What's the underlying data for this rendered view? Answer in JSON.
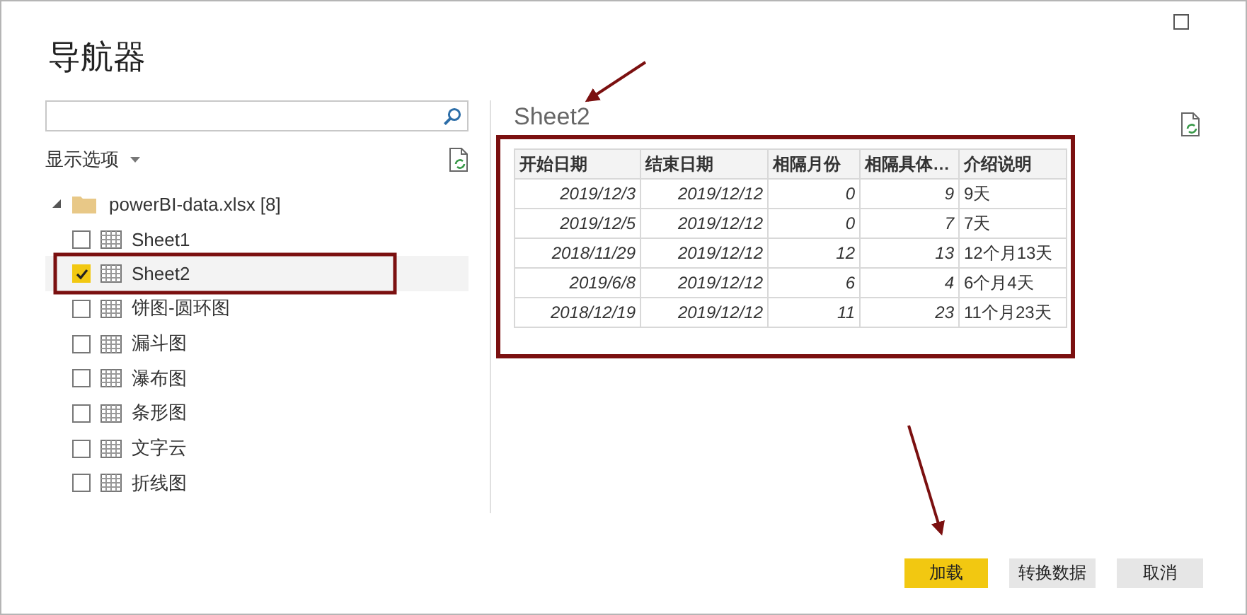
{
  "window": {
    "title": "导航器"
  },
  "display_options": {
    "label": "显示选项"
  },
  "tree": {
    "label": "powerBI-data.xlsx [8]",
    "expanded": true,
    "children": [
      {
        "label": "Sheet1",
        "checked": false,
        "selected": false
      },
      {
        "label": "Sheet2",
        "checked": true,
        "selected": true
      },
      {
        "label": "饼图-圆环图",
        "checked": false,
        "selected": false
      },
      {
        "label": "漏斗图",
        "checked": false,
        "selected": false
      },
      {
        "label": "瀑布图",
        "checked": false,
        "selected": false
      },
      {
        "label": "条形图",
        "checked": false,
        "selected": false
      },
      {
        "label": "文字云",
        "checked": false,
        "selected": false
      },
      {
        "label": "折线图",
        "checked": false,
        "selected": false
      }
    ]
  },
  "preview": {
    "title": "Sheet2",
    "table": {
      "columns": [
        "开始日期",
        "结束日期",
        "相隔月份",
        "相隔具体…",
        "介绍说明"
      ],
      "rows": [
        [
          "2019/12/3",
          "2019/12/12",
          "0",
          "9",
          "9天"
        ],
        [
          "2019/12/5",
          "2019/12/12",
          "0",
          "7",
          "7天"
        ],
        [
          "2018/11/29",
          "2019/12/12",
          "12",
          "13",
          "12个月13天"
        ],
        [
          "2019/6/8",
          "2019/12/12",
          "6",
          "4",
          "6个月4天"
        ],
        [
          "2018/12/19",
          "2019/12/12",
          "11",
          "23",
          "11个月23天"
        ]
      ]
    }
  },
  "buttons": [
    {
      "label": "加载",
      "kind": "primary"
    },
    {
      "label": "转换数据",
      "kind": "secondary"
    },
    {
      "label": "取消",
      "kind": "secondary"
    }
  ]
}
